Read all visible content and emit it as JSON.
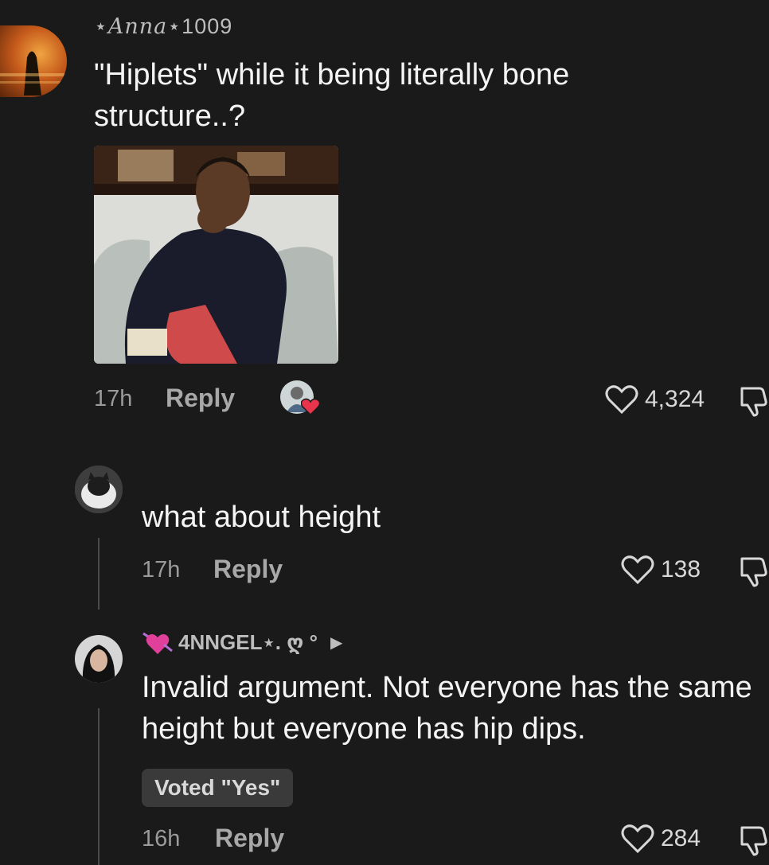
{
  "comments": [
    {
      "username_fancy": "Anna",
      "username_prefix": "⋆",
      "username_suffix": "⋆1009",
      "text": "\"Hiplets\" while it being literally bone structure..?",
      "time": "17h",
      "reply_label": "Reply",
      "likes": "4,324"
    },
    {
      "text": "what about height",
      "time": "17h",
      "reply_label": "Reply",
      "likes": "138"
    },
    {
      "username": "4NNGEL⋆. ღ °",
      "text": "Invalid argument. Not everyone has the same height but everyone has hip dips.",
      "vote_badge": "Voted \"Yes\"",
      "time": "16h",
      "reply_label": "Reply",
      "likes": "284"
    }
  ],
  "colors": {
    "background": "#1a1a1a",
    "text": "#f4f4f4",
    "muted": "#9b9b9b",
    "heart_badge": "#e8344c"
  }
}
